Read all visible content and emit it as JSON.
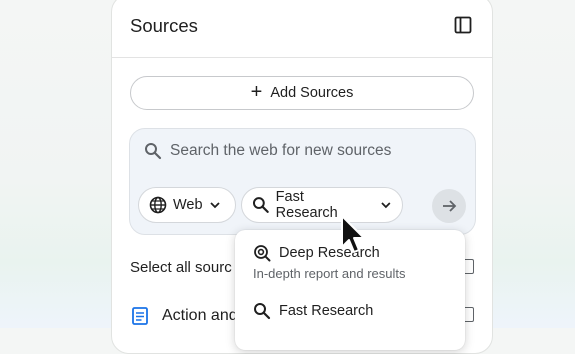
{
  "panel": {
    "title": "Sources",
    "collapse_icon": "dock-panel-icon"
  },
  "add_sources": {
    "label": "Add Sources",
    "icon": "plus-icon"
  },
  "search": {
    "placeholder": "Search the web for new sources",
    "source_chip": "Web",
    "mode_chip": "Fast Research",
    "submit_icon": "arrow-right-icon"
  },
  "list": {
    "select_all": "Select all sourc",
    "items": [
      {
        "title": "Action and",
        "icon": "document-icon"
      }
    ]
  },
  "dropdown": {
    "options": [
      {
        "label": "Deep Research",
        "description": "In-depth report and results",
        "icon": "deep-research-icon"
      },
      {
        "label": "Fast Research",
        "description": "",
        "icon": "search-icon"
      }
    ]
  },
  "colors": {
    "panel_bg": "#ffffff",
    "search_card_bg": "#f0f4f9",
    "text": "#1f1f1f",
    "muted": "#5f6368"
  }
}
